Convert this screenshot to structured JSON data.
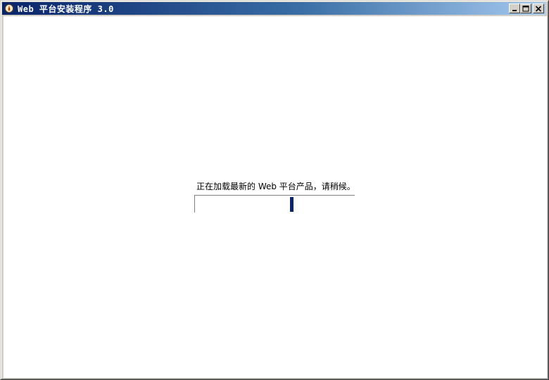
{
  "window": {
    "title": "Web 平台安装程序 3.0",
    "icon": "web-platform-installer-icon",
    "controls": {
      "minimize": "minimize-icon",
      "maximize": "maximize-icon",
      "close": "close-icon"
    }
  },
  "main": {
    "status_text": "正在加载最新的 Web 平台产品，请稍候。",
    "progress": {
      "type": "marquee",
      "position_fraction": 0.61,
      "color": "#0a246a"
    }
  },
  "colors": {
    "titlebar_start": "#0a246a",
    "titlebar_end": "#a6caf0",
    "client_background": "#ffffff",
    "chrome": "#d4d0c8"
  }
}
